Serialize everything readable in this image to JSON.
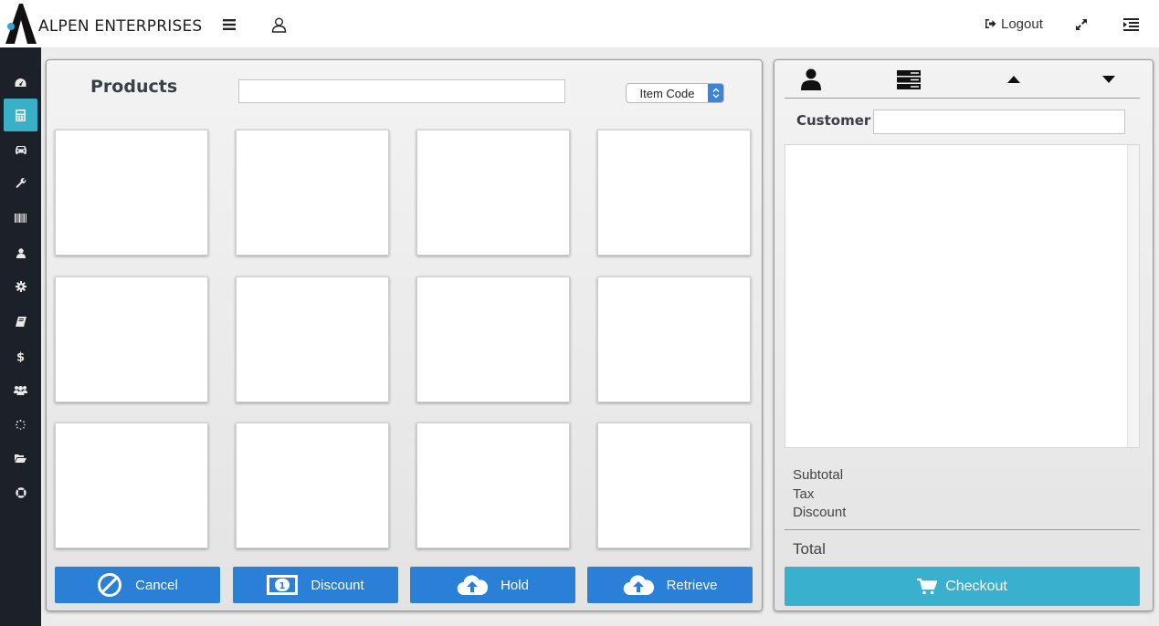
{
  "brand": {
    "name": "ALPEN ENTERPRISES"
  },
  "topbar": {
    "menu_icon": "hamburger-icon",
    "user_icon": "user-outline-icon",
    "logout_label": "Logout",
    "logout_icon": "sign-out-icon",
    "expand_icon": "expand-arrows-icon",
    "sidebar_toggle_icon": "indent-icon"
  },
  "sidebar": {
    "active_color": "#3ab0c8",
    "items": [
      {
        "icon": "dashboard-icon"
      },
      {
        "icon": "calculator-icon",
        "active": true
      },
      {
        "icon": "car-icon"
      },
      {
        "icon": "wrench-icon"
      },
      {
        "icon": "barcode-icon"
      },
      {
        "icon": "user-icon"
      },
      {
        "icon": "gear-icon"
      },
      {
        "icon": "book-icon"
      },
      {
        "icon": "dollar-icon"
      },
      {
        "icon": "users-icon"
      },
      {
        "icon": "spinner-icon"
      },
      {
        "icon": "folder-open-icon"
      },
      {
        "icon": "life-ring-icon"
      }
    ]
  },
  "products": {
    "title": "Products",
    "search_value": "",
    "search_placeholder": "",
    "filter_selected": "Item Code",
    "tile_count": 12,
    "actions": [
      {
        "label": "Cancel",
        "icon": "ban-icon"
      },
      {
        "label": "Discount",
        "icon": "money-icon"
      },
      {
        "label": "Hold",
        "icon": "cloud-upload-icon"
      },
      {
        "label": "Retrieve",
        "icon": "cloud-upload-icon"
      }
    ],
    "button_color": "#2a7fd6"
  },
  "cart": {
    "header_icons": [
      "user-icon",
      "server-icon",
      "caret-up-icon",
      "caret-down-icon"
    ],
    "customer_label": "Customer",
    "customer_value": "",
    "subtotal_label": "Subtotal",
    "tax_label": "Tax",
    "discount_label": "Discount",
    "total_label": "Total",
    "checkout_label": "Checkout",
    "checkout_icon": "shopping-cart-icon",
    "checkout_color": "#3ab0cf"
  }
}
